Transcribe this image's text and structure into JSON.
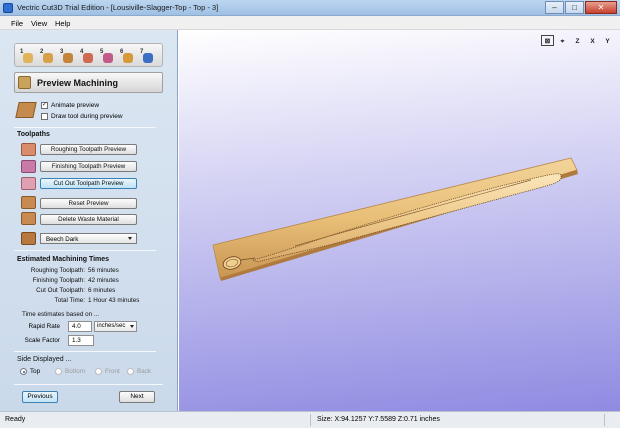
{
  "window": {
    "title": "Vectric Cut3D Trial Edition - [Lousiville-Slagger-Top - Top - 3]",
    "minimize": "–",
    "maximize": "□",
    "close": "✕"
  },
  "menu": {
    "file": "File",
    "view": "View",
    "help": "Help"
  },
  "toolstrip": {
    "steps": [
      {
        "num": "1",
        "color": "#e0b45a"
      },
      {
        "num": "2",
        "color": "#d9a04a"
      },
      {
        "num": "3",
        "color": "#c4843b"
      },
      {
        "num": "4",
        "color": "#cf6a55"
      },
      {
        "num": "5",
        "color": "#c25a8a"
      },
      {
        "num": "6",
        "color": "#d69a3a"
      },
      {
        "num": "7",
        "color": "#3a6fc4"
      }
    ]
  },
  "section": {
    "title": "Preview Machining"
  },
  "options": {
    "animate_preview": "Animate preview",
    "draw_tool": "Draw tool during preview"
  },
  "toolpaths": {
    "heading": "Toolpaths",
    "roughing_btn": "Roughing Toolpath Preview",
    "finishing_btn": "Finishing Toolpath Preview",
    "cutout_btn": "Cut Out Toolpath Preview",
    "reset_btn": "Reset Preview",
    "delete_waste_btn": "Delete Waste Material",
    "material": "Beech Dark"
  },
  "times": {
    "heading": "Estimated Machining Times",
    "rows": [
      {
        "label": "Roughing Toolpath:",
        "value": "56 minutes"
      },
      {
        "label": "Finishing Toolpath:",
        "value": "42 minutes"
      },
      {
        "label": "Cut Out Toolpath:",
        "value": "6 minutes"
      },
      {
        "label": "Total Time:",
        "value": "1 Hour 43 minutes"
      }
    ],
    "based_on": "Time estimates based on ...",
    "rapid_rate_label": "Rapid Rate",
    "rapid_rate_value": "4.0",
    "rapid_rate_unit": "inches/sec",
    "scale_factor_label": "Scale Factor",
    "scale_factor_value": "1.3"
  },
  "sides": {
    "heading": "Side Displayed ...",
    "top": "Top",
    "bottom": "Bottom",
    "front": "Front",
    "back": "Back",
    "selected": "Top"
  },
  "nav": {
    "previous": "Previous",
    "next": "Next"
  },
  "viewport": {
    "icons": [
      "frame-icon",
      "iso-view-icon",
      "z-view-icon",
      "x-view-icon",
      "y-view-icon"
    ],
    "icon_labels": [
      "⊠",
      "⌖",
      "Z",
      "X",
      "Y"
    ]
  },
  "status": {
    "ready": "Ready",
    "size": "Size: X:94.1257 Y:7.5589 Z:0.71 inches"
  },
  "colors": {
    "board": "#e8bf78",
    "board_edge": "#b8894a",
    "viewport_bottom": "#8f8be2"
  }
}
